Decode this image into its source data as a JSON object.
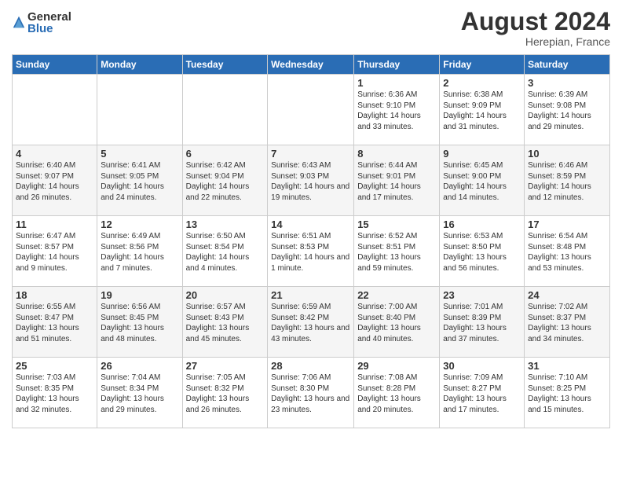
{
  "header": {
    "logo_general": "General",
    "logo_blue": "Blue",
    "month_title": "August 2024",
    "location": "Herepian, France"
  },
  "days_of_week": [
    "Sunday",
    "Monday",
    "Tuesday",
    "Wednesday",
    "Thursday",
    "Friday",
    "Saturday"
  ],
  "weeks": [
    [
      {
        "day": "",
        "sunrise": "",
        "sunset": "",
        "daylight": ""
      },
      {
        "day": "",
        "sunrise": "",
        "sunset": "",
        "daylight": ""
      },
      {
        "day": "",
        "sunrise": "",
        "sunset": "",
        "daylight": ""
      },
      {
        "day": "",
        "sunrise": "",
        "sunset": "",
        "daylight": ""
      },
      {
        "day": "1",
        "sunrise": "Sunrise: 6:36 AM",
        "sunset": "Sunset: 9:10 PM",
        "daylight": "Daylight: 14 hours and 33 minutes."
      },
      {
        "day": "2",
        "sunrise": "Sunrise: 6:38 AM",
        "sunset": "Sunset: 9:09 PM",
        "daylight": "Daylight: 14 hours and 31 minutes."
      },
      {
        "day": "3",
        "sunrise": "Sunrise: 6:39 AM",
        "sunset": "Sunset: 9:08 PM",
        "daylight": "Daylight: 14 hours and 29 minutes."
      }
    ],
    [
      {
        "day": "4",
        "sunrise": "Sunrise: 6:40 AM",
        "sunset": "Sunset: 9:07 PM",
        "daylight": "Daylight: 14 hours and 26 minutes."
      },
      {
        "day": "5",
        "sunrise": "Sunrise: 6:41 AM",
        "sunset": "Sunset: 9:05 PM",
        "daylight": "Daylight: 14 hours and 24 minutes."
      },
      {
        "day": "6",
        "sunrise": "Sunrise: 6:42 AM",
        "sunset": "Sunset: 9:04 PM",
        "daylight": "Daylight: 14 hours and 22 minutes."
      },
      {
        "day": "7",
        "sunrise": "Sunrise: 6:43 AM",
        "sunset": "Sunset: 9:03 PM",
        "daylight": "Daylight: 14 hours and 19 minutes."
      },
      {
        "day": "8",
        "sunrise": "Sunrise: 6:44 AM",
        "sunset": "Sunset: 9:01 PM",
        "daylight": "Daylight: 14 hours and 17 minutes."
      },
      {
        "day": "9",
        "sunrise": "Sunrise: 6:45 AM",
        "sunset": "Sunset: 9:00 PM",
        "daylight": "Daylight: 14 hours and 14 minutes."
      },
      {
        "day": "10",
        "sunrise": "Sunrise: 6:46 AM",
        "sunset": "Sunset: 8:59 PM",
        "daylight": "Daylight: 14 hours and 12 minutes."
      }
    ],
    [
      {
        "day": "11",
        "sunrise": "Sunrise: 6:47 AM",
        "sunset": "Sunset: 8:57 PM",
        "daylight": "Daylight: 14 hours and 9 minutes."
      },
      {
        "day": "12",
        "sunrise": "Sunrise: 6:49 AM",
        "sunset": "Sunset: 8:56 PM",
        "daylight": "Daylight: 14 hours and 7 minutes."
      },
      {
        "day": "13",
        "sunrise": "Sunrise: 6:50 AM",
        "sunset": "Sunset: 8:54 PM",
        "daylight": "Daylight: 14 hours and 4 minutes."
      },
      {
        "day": "14",
        "sunrise": "Sunrise: 6:51 AM",
        "sunset": "Sunset: 8:53 PM",
        "daylight": "Daylight: 14 hours and 1 minute."
      },
      {
        "day": "15",
        "sunrise": "Sunrise: 6:52 AM",
        "sunset": "Sunset: 8:51 PM",
        "daylight": "Daylight: 13 hours and 59 minutes."
      },
      {
        "day": "16",
        "sunrise": "Sunrise: 6:53 AM",
        "sunset": "Sunset: 8:50 PM",
        "daylight": "Daylight: 13 hours and 56 minutes."
      },
      {
        "day": "17",
        "sunrise": "Sunrise: 6:54 AM",
        "sunset": "Sunset: 8:48 PM",
        "daylight": "Daylight: 13 hours and 53 minutes."
      }
    ],
    [
      {
        "day": "18",
        "sunrise": "Sunrise: 6:55 AM",
        "sunset": "Sunset: 8:47 PM",
        "daylight": "Daylight: 13 hours and 51 minutes."
      },
      {
        "day": "19",
        "sunrise": "Sunrise: 6:56 AM",
        "sunset": "Sunset: 8:45 PM",
        "daylight": "Daylight: 13 hours and 48 minutes."
      },
      {
        "day": "20",
        "sunrise": "Sunrise: 6:57 AM",
        "sunset": "Sunset: 8:43 PM",
        "daylight": "Daylight: 13 hours and 45 minutes."
      },
      {
        "day": "21",
        "sunrise": "Sunrise: 6:59 AM",
        "sunset": "Sunset: 8:42 PM",
        "daylight": "Daylight: 13 hours and 43 minutes."
      },
      {
        "day": "22",
        "sunrise": "Sunrise: 7:00 AM",
        "sunset": "Sunset: 8:40 PM",
        "daylight": "Daylight: 13 hours and 40 minutes."
      },
      {
        "day": "23",
        "sunrise": "Sunrise: 7:01 AM",
        "sunset": "Sunset: 8:39 PM",
        "daylight": "Daylight: 13 hours and 37 minutes."
      },
      {
        "day": "24",
        "sunrise": "Sunrise: 7:02 AM",
        "sunset": "Sunset: 8:37 PM",
        "daylight": "Daylight: 13 hours and 34 minutes."
      }
    ],
    [
      {
        "day": "25",
        "sunrise": "Sunrise: 7:03 AM",
        "sunset": "Sunset: 8:35 PM",
        "daylight": "Daylight: 13 hours and 32 minutes."
      },
      {
        "day": "26",
        "sunrise": "Sunrise: 7:04 AM",
        "sunset": "Sunset: 8:34 PM",
        "daylight": "Daylight: 13 hours and 29 minutes."
      },
      {
        "day": "27",
        "sunrise": "Sunrise: 7:05 AM",
        "sunset": "Sunset: 8:32 PM",
        "daylight": "Daylight: 13 hours and 26 minutes."
      },
      {
        "day": "28",
        "sunrise": "Sunrise: 7:06 AM",
        "sunset": "Sunset: 8:30 PM",
        "daylight": "Daylight: 13 hours and 23 minutes."
      },
      {
        "day": "29",
        "sunrise": "Sunrise: 7:08 AM",
        "sunset": "Sunset: 8:28 PM",
        "daylight": "Daylight: 13 hours and 20 minutes."
      },
      {
        "day": "30",
        "sunrise": "Sunrise: 7:09 AM",
        "sunset": "Sunset: 8:27 PM",
        "daylight": "Daylight: 13 hours and 17 minutes."
      },
      {
        "day": "31",
        "sunrise": "Sunrise: 7:10 AM",
        "sunset": "Sunset: 8:25 PM",
        "daylight": "Daylight: 13 hours and 15 minutes."
      }
    ]
  ]
}
